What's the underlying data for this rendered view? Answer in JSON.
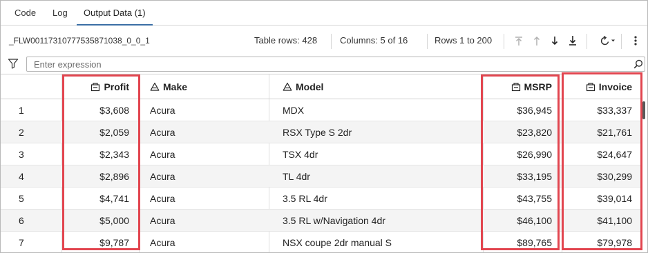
{
  "tabs": [
    {
      "label": "Code",
      "active": false
    },
    {
      "label": "Log",
      "active": false
    },
    {
      "label": "Output Data (1)",
      "active": true
    }
  ],
  "toolbar": {
    "dataset_name": "_FLW00117310777535871038_0_0_1",
    "table_rows": "Table rows: 428",
    "columns": "Columns: 5 of 16",
    "rows_range": "Rows 1 to 200",
    "icons": [
      "first-page-icon",
      "previous-page-icon",
      "next-page-icon",
      "last-page-icon",
      "refresh-icon",
      "more-options-icon"
    ]
  },
  "filter": {
    "placeholder": "Enter expression"
  },
  "table": {
    "headers": {
      "profit": "Profit",
      "make": "Make",
      "model": "Model",
      "msrp": "MSRP",
      "invoice": "Invoice"
    },
    "rows": [
      {
        "idx": "1",
        "profit": "$3,608",
        "make": "Acura",
        "model": "MDX",
        "msrp": "$36,945",
        "invoice": "$33,337"
      },
      {
        "idx": "2",
        "profit": "$2,059",
        "make": "Acura",
        "model": "RSX Type S 2dr",
        "msrp": "$23,820",
        "invoice": "$21,761"
      },
      {
        "idx": "3",
        "profit": "$2,343",
        "make": "Acura",
        "model": "TSX 4dr",
        "msrp": "$26,990",
        "invoice": "$24,647"
      },
      {
        "idx": "4",
        "profit": "$2,896",
        "make": "Acura",
        "model": "TL 4dr",
        "msrp": "$33,195",
        "invoice": "$30,299"
      },
      {
        "idx": "5",
        "profit": "$4,741",
        "make": "Acura",
        "model": "3.5 RL 4dr",
        "msrp": "$43,755",
        "invoice": "$39,014"
      },
      {
        "idx": "6",
        "profit": "$5,000",
        "make": "Acura",
        "model": "3.5 RL w/Navigation 4dr",
        "msrp": "$46,100",
        "invoice": "$41,100"
      },
      {
        "idx": "7",
        "profit": "$9,787",
        "make": "Acura",
        "model": "NSX coupe 2dr manual S",
        "msrp": "$89,765",
        "invoice": "$79,978"
      }
    ]
  },
  "colors": {
    "highlight": "#e2454f",
    "active_tab": "#3a6ea5",
    "alt_row": "#f4f4f4"
  }
}
